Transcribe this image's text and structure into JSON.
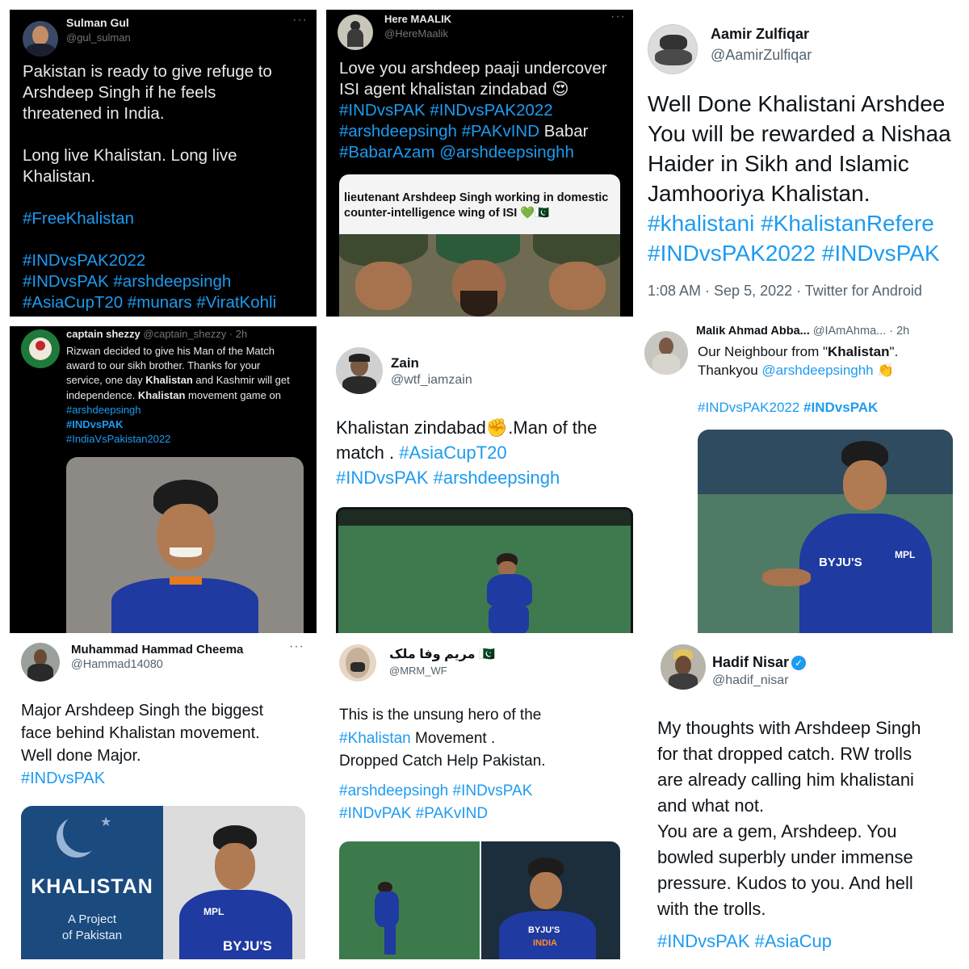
{
  "tiles": {
    "t1": {
      "name": "Sulman Gul",
      "handle": "@gul_sulman",
      "lines": [
        "Pakistan is ready to give refuge to",
        "Arshdeep Singh if he feels",
        "threatened in India."
      ],
      "lines2": [
        "Long live Khalistan. Long live",
        "Khalistan."
      ],
      "tag1": "#FreeKhalistan",
      "tags": [
        "#INDvsPAK2022",
        "#INDvsPAK #arshdeepsingh",
        "#AsiaCupT20 #munars #ViratKohli"
      ]
    },
    "t2": {
      "name": "Here MAALIK",
      "handle": "@HereMaalik",
      "line1": "Love you arshdeep paaji undercover",
      "line2": "ISI agent khalistan zindabad 😍",
      "tag1": "#INDvsPAK #INDvsPAK2022",
      "tag2a": "#arshdeepsingh #PAKvIND",
      "tag2b": " Babar",
      "tag3": "#BabarAzam @arshdeepsinghh",
      "meme_line1": "lieutenant Arshdeep Singh working in domestic",
      "meme_line2": "counter-intelligence wing of ISI 💚🇵🇰"
    },
    "t3": {
      "name": "Aamir Zulfiqar",
      "handle": "@AamirZulfiqar",
      "lines": [
        "Well Done Khalistani Arshdee",
        "You will be rewarded a Nishaa",
        "Haider in Sikh and Islamic",
        "Jamhooriya Khalistan."
      ],
      "tags": [
        "#khalistani #KhalistanRefere",
        "#INDvsPAK2022 #INDvsPAK"
      ],
      "meta": "1:08 AM · Sep 5, 2022 · Twitter for Android"
    },
    "t4": {
      "name": "captain shezzy",
      "handle": "@captain_shezzy · 2h",
      "text1": "Rizwan decided to give his Man of the Match",
      "text2": "award to our sikh brother. Thanks for your",
      "text3a": "service, one day ",
      "text3b": "Khalistan",
      "text3c": " and Kashmir will get",
      "text4a": "independence. ",
      "text4b": "Khalistan",
      "text4c": " movement game on",
      "tag1": "#arshdeepsingh",
      "tag2": "#INDvsPAK",
      "tag3": "#IndiaVsPakistan2022"
    },
    "t5": {
      "name": "Zain",
      "handle": "@wtf_iamzain",
      "line1": "Khalistan zindabad✊.Man of the",
      "line2a": "match . ",
      "line2b": "#AsiaCupT20",
      "line3": "#INDvsPAK #arshdeepsingh"
    },
    "t6": {
      "name": "Malik Ahmad Abba...",
      "handle": "@IAmAhma...",
      "time": "· 2h",
      "line1a": "Our Neighbour from \"",
      "line1b": "Khalistan",
      "line1c": "\".",
      "line2a": "Thankyou ",
      "line2b": "@arshdeepsinghh",
      "line2c": " 👏",
      "tag": "#INDvsPAK2022",
      "tagb": "#INDvsPAK",
      "jersey_brand": "BYJU'S",
      "jersey_mpl": "MPL"
    },
    "t7": {
      "name": "Muhammad Hammad Cheema",
      "handle": "@Hammad14080",
      "lines": [
        "Major Arshdeep Singh the biggest",
        "face behind Khalistan movement.",
        "Well done Major."
      ],
      "tag": "#INDvsPAK",
      "poster_title": "KHALISTAN",
      "poster_sub1": "A Project",
      "poster_sub2": "of Pakistan",
      "jersey_brand": "BYJU'S",
      "jersey_mpl": "MPL"
    },
    "t8": {
      "name": "مریم وفا ملک 🇵🇰",
      "handle": "@MRM_WF",
      "line1": "This is the unsung hero of the",
      "line2a": "#Khalistan",
      "line2b": " Movement .",
      "line3": "Dropped Catch Help Pakistan.",
      "tag1": "#arshdeepsingh #INDvsPAK",
      "tag2": "#INDvPAK #PAKvIND",
      "jersey_brand": "BYJU'S",
      "jersey_country": "INDIA"
    },
    "t9": {
      "name": "Hadif Nisar",
      "handle": "@hadif_nisar",
      "lines": [
        "My thoughts with Arshdeep Singh",
        "for that dropped catch. RW trolls",
        "are already calling him khalistani",
        "and what not.",
        "You are a gem, Arshdeep. You",
        "bowled superbly under immense",
        "pressure. Kudos to you. And hell",
        "with the trolls."
      ],
      "tag": "#INDvsPAK #AsiaCup"
    }
  }
}
